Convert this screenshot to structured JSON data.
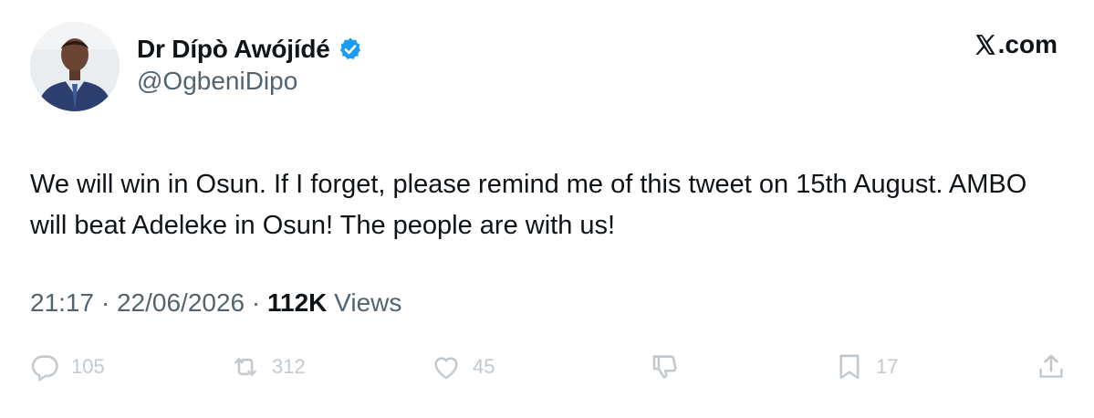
{
  "author": {
    "display_name": "Dr Dípò Awójídé",
    "handle": "@OgbeniDipo",
    "verified": true,
    "avatar_icon": "profile-photo"
  },
  "site": {
    "label": ".com",
    "logo_icon": "x-logo-icon"
  },
  "tweet": {
    "text": "We will win in Osun. If I forget, please remind me of this tweet on 15th August. AMBO will beat Adeleke in Osun! The people are with us!",
    "time": "21:17",
    "date": "22/06/2026",
    "separator": " · ",
    "views_count": "112K",
    "views_label": " Views"
  },
  "actions": {
    "replies": "105",
    "reposts": "312",
    "likes": "45",
    "bookmarks": "17"
  },
  "colors": {
    "verified_blue": "#1d9bf0",
    "text_primary": "#0f1419",
    "text_secondary": "#536471",
    "action_faded": "#b7c0c7"
  }
}
